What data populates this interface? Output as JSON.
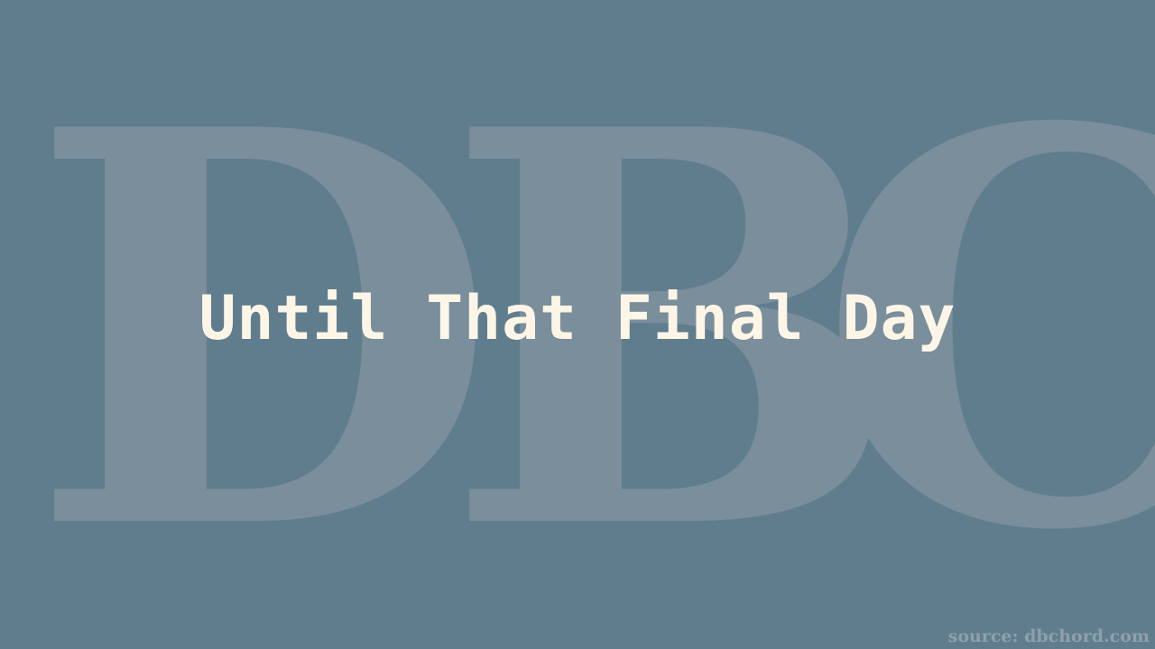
{
  "watermark": {
    "letters": [
      "D",
      "B",
      "C"
    ]
  },
  "slide": {
    "title": "Until That Final Day"
  },
  "footer": {
    "source": "source: dbchord.com"
  },
  "colors": {
    "background": "#607d8e",
    "watermark": "#7a8e9b",
    "title": "#fdf5e6",
    "source": "#8ea0ab"
  }
}
